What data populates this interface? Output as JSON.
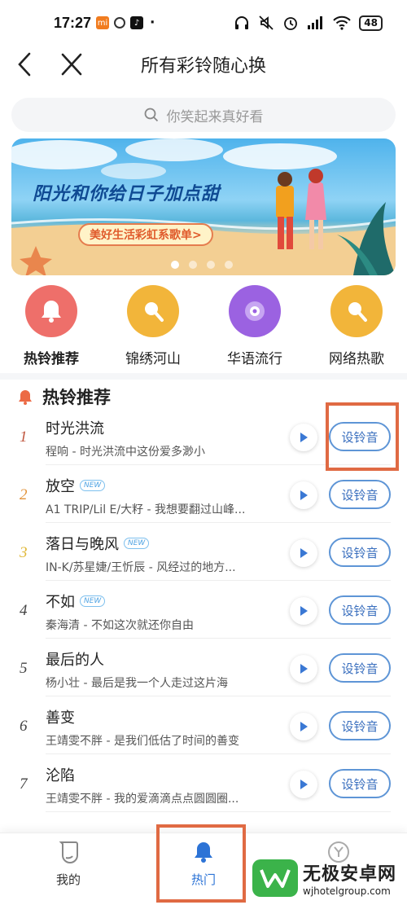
{
  "status_bar": {
    "time": "17:27",
    "battery": "48"
  },
  "header": {
    "title": "所有彩铃随心换"
  },
  "search": {
    "placeholder": "你笑起来真好看"
  },
  "banner": {
    "title": "阳光和你给日子加点甜",
    "subtitle": "美好生活彩虹系歌单>",
    "active_dot": 1,
    "dot_count": 4
  },
  "categories": [
    {
      "label": "热铃推荐",
      "color": "#ee6f6a",
      "icon": "bell-icon"
    },
    {
      "label": "锦绣河山",
      "color": "#f2b53a",
      "icon": "microphone-icon"
    },
    {
      "label": "华语流行",
      "color": "#9b62e1",
      "icon": "speaker-icon"
    },
    {
      "label": "网络热歌",
      "color": "#f2b53a",
      "icon": "microphone-icon"
    }
  ],
  "section": {
    "title": "热铃推荐"
  },
  "songs": [
    {
      "rank": "1",
      "title": "时光洪流",
      "is_new": false,
      "sub": "程响 - 时光洪流中这份爱多渺小",
      "button": "设铃音",
      "rank_color": "#c0573f"
    },
    {
      "rank": "2",
      "title": "放空",
      "is_new": true,
      "sub": "A1 TRIP/Lil E/大籽 - 我想要翻过山峰...",
      "button": "设铃音",
      "rank_color": "#e2933a"
    },
    {
      "rank": "3",
      "title": "落日与晚风",
      "is_new": true,
      "sub": "IN-K/苏星婕/王忻辰 - 风经过的地方...",
      "button": "设铃音",
      "rank_color": "#e0b736"
    },
    {
      "rank": "4",
      "title": "不如",
      "is_new": true,
      "sub": "秦海清 - 不如这次就还你自由",
      "button": "设铃音",
      "rank_color": "#444444"
    },
    {
      "rank": "5",
      "title": "最后的人",
      "is_new": false,
      "sub": "杨小壮 - 最后是我一个人走过这片海",
      "button": "设铃音",
      "rank_color": "#444444"
    },
    {
      "rank": "6",
      "title": "善变",
      "is_new": false,
      "sub": "王靖雯不胖 - 是我们低估了时间的善变",
      "button": "设铃音",
      "rank_color": "#444444"
    },
    {
      "rank": "7",
      "title": "沦陷",
      "is_new": false,
      "sub": "王靖雯不胖 - 我的爱滴滴点点圆圆圈...",
      "button": "设铃音",
      "rank_color": "#444444"
    }
  ],
  "new_badge": "NEW",
  "bottom_nav": {
    "mine_label": "我的",
    "hot_label": "热门"
  },
  "watermark": {
    "main": "无极安卓网",
    "sub": "wjhotelgroup.com"
  }
}
